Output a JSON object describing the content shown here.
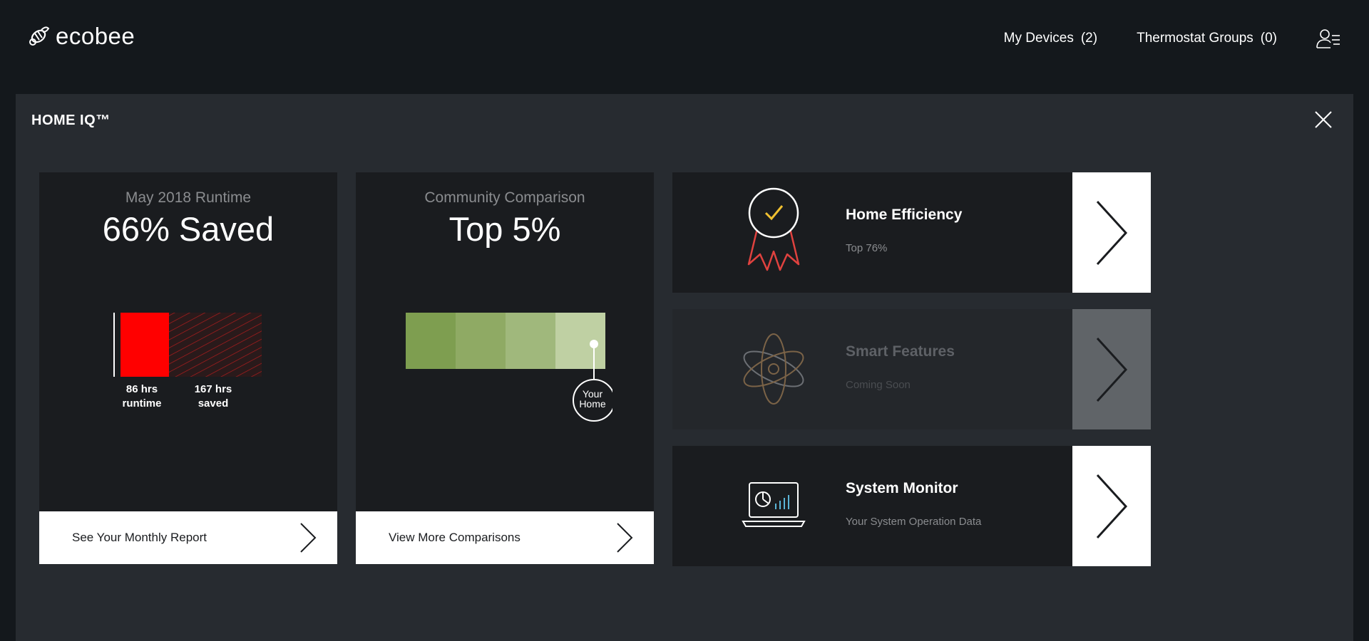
{
  "brand": {
    "name": "ecobee"
  },
  "nav": {
    "devices_label": "My Devices",
    "devices_count": "(2)",
    "groups_label": "Thermostat Groups",
    "groups_count": "(0)"
  },
  "panel": {
    "title": "HOME IQ™"
  },
  "runtime_card": {
    "label": "May 2018 Runtime",
    "value": "66% Saved",
    "runtime_hrs": "86 hrs",
    "runtime_word": "runtime",
    "saved_hrs": "167 hrs",
    "saved_word": "saved",
    "footer_label": "See Your Monthly Report",
    "colors": {
      "runtime": "#ff0000",
      "saved": "#b31c1c"
    }
  },
  "community_card": {
    "label": "Community Comparison",
    "value": "Top 5%",
    "marker_line1": "Your",
    "marker_line2": "Home",
    "footer_label": "View More Comparisons",
    "segment_colors": [
      "#7e9e50",
      "#8faa64",
      "#a0b87c",
      "#bfd0a3"
    ]
  },
  "features": [
    {
      "title": "Home Efficiency",
      "subtitle": "Top 76%",
      "icon": "award-ribbon-icon"
    },
    {
      "title": "Smart Features",
      "subtitle": "Coming Soon",
      "icon": "atom-icon"
    },
    {
      "title": "System Monitor",
      "subtitle": "Your System Operation Data",
      "icon": "laptop-chart-icon"
    }
  ]
}
